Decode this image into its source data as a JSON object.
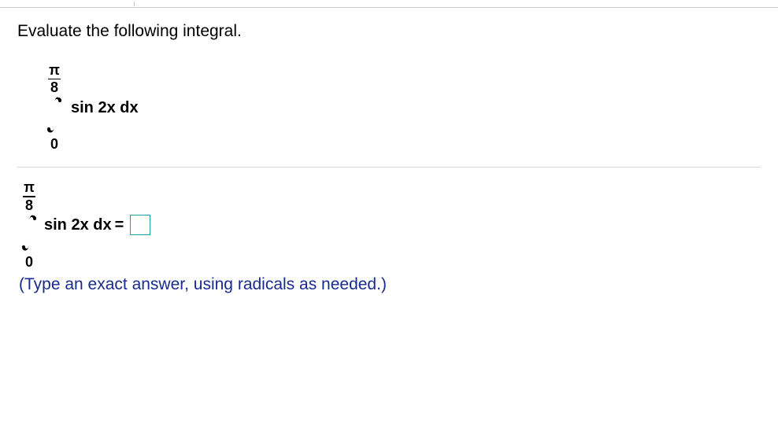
{
  "question": {
    "prompt": "Evaluate the following integral."
  },
  "integral_display": {
    "upper_num": "π",
    "upper_den": "8",
    "lower": "0",
    "expr": "sin 2x dx"
  },
  "answer_line": {
    "upper_num": "π",
    "upper_den": "8",
    "lower": "0",
    "expr": "sin 2x dx",
    "equals": "=",
    "input_value": ""
  },
  "hint": "(Type an exact answer, using radicals as needed.)"
}
